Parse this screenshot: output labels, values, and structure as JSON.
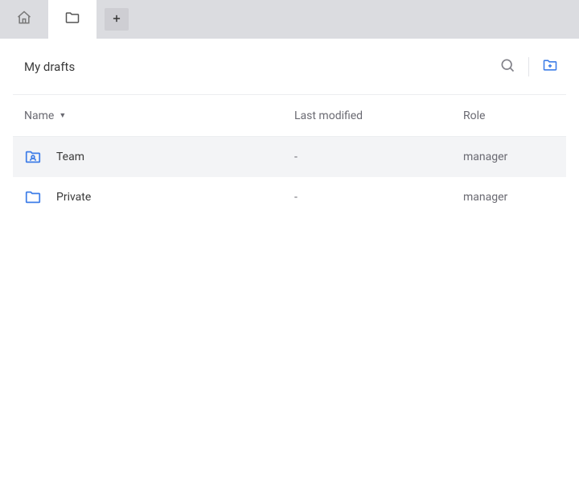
{
  "tabs": {
    "home_icon": "home-icon",
    "folder_icon": "folder-icon",
    "plus_icon": "plus-icon"
  },
  "header": {
    "title": "My drafts"
  },
  "columns": {
    "name": "Name",
    "modified": "Last modified",
    "role": "Role"
  },
  "rows": [
    {
      "name": "Team",
      "modified": "-",
      "role": "manager",
      "icon": "team-folder"
    },
    {
      "name": "Private",
      "modified": "-",
      "role": "manager",
      "icon": "folder"
    }
  ]
}
